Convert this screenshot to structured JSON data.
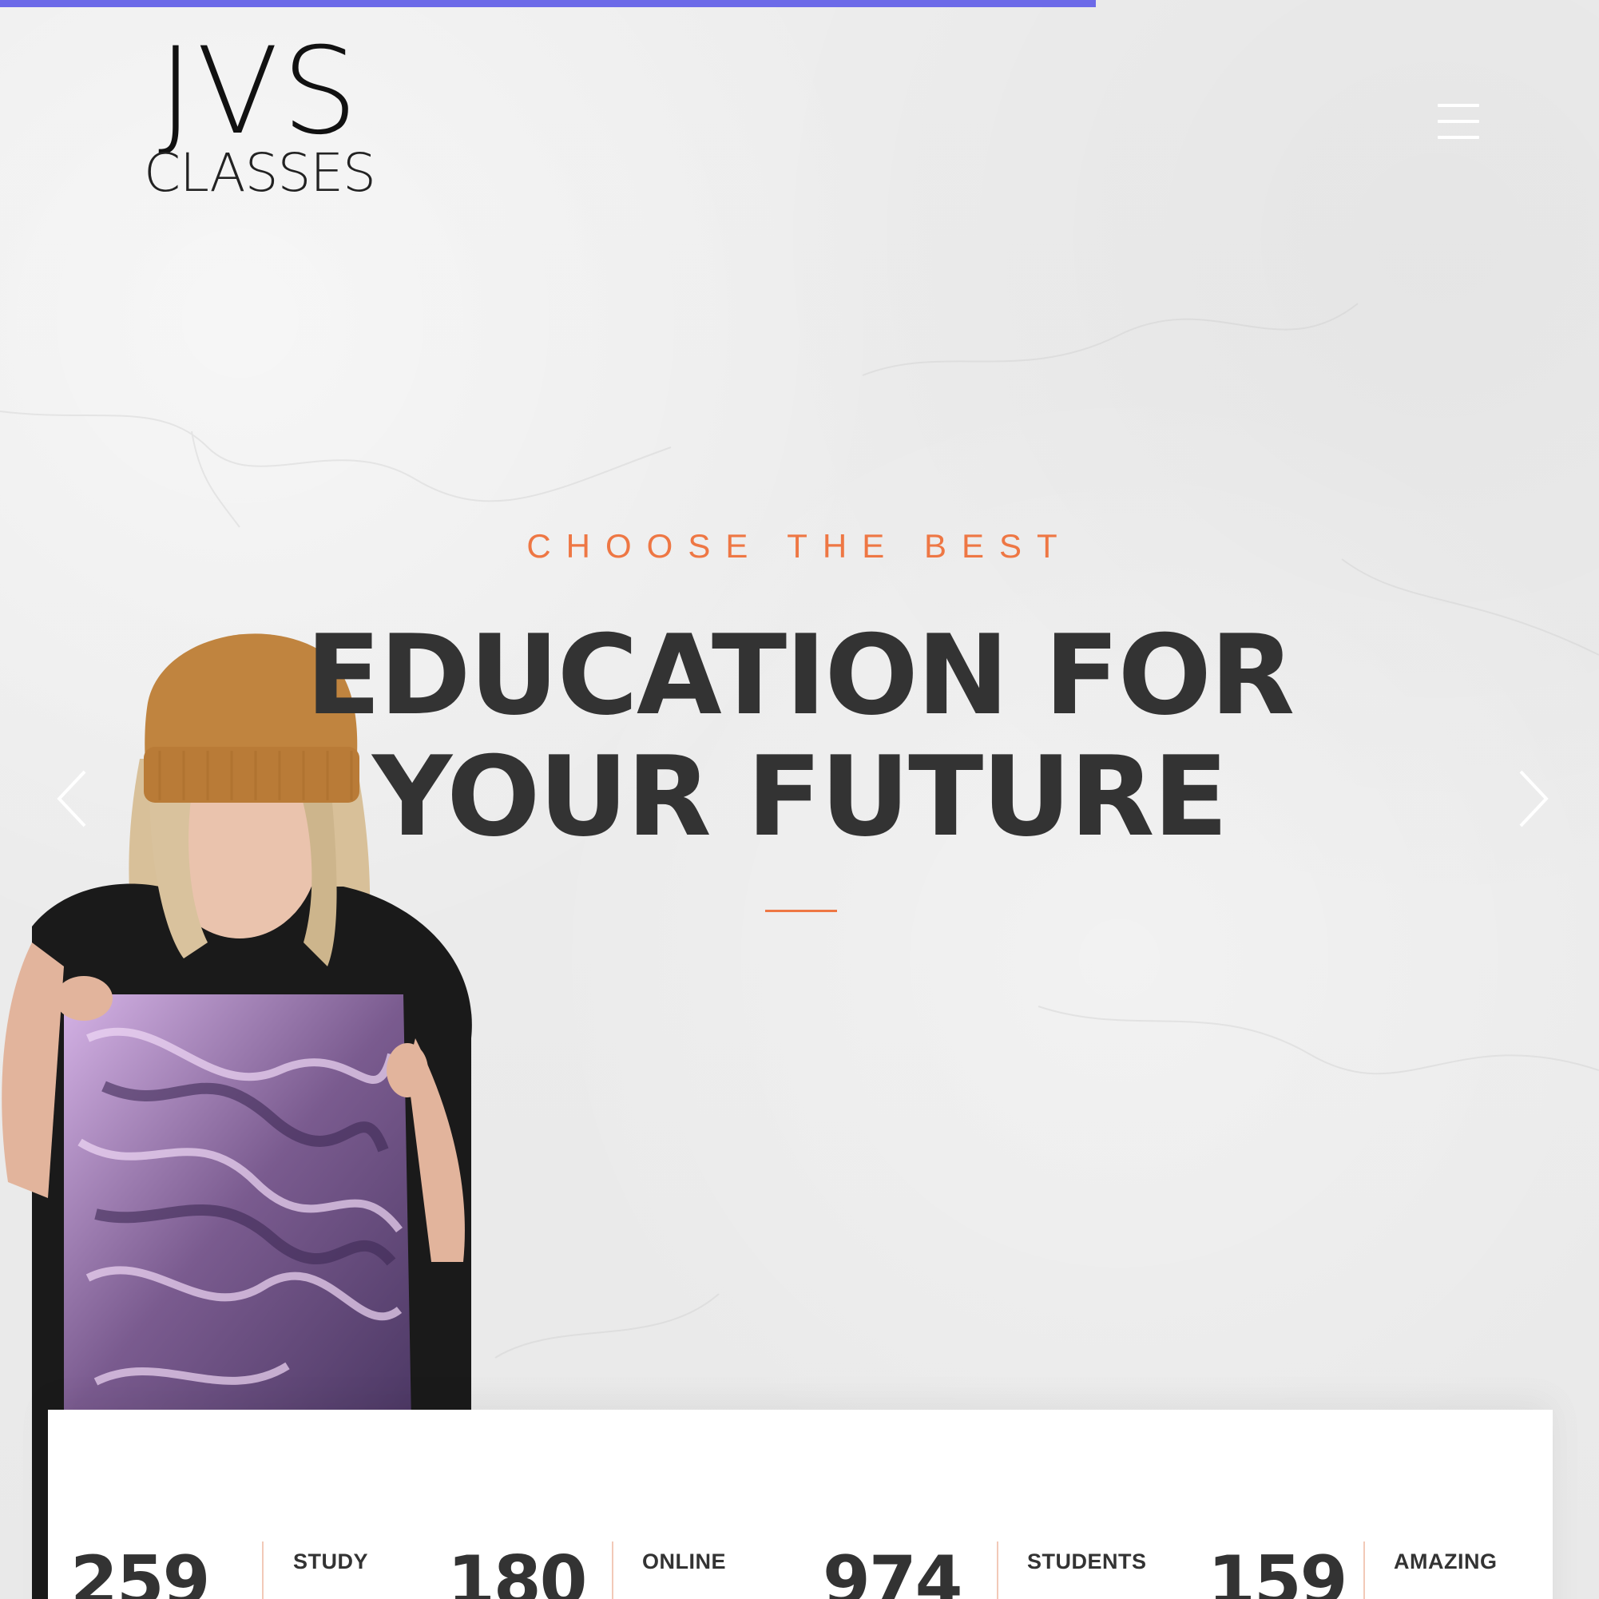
{
  "brand": {
    "logo_main": "JVS",
    "logo_sub": "CLASSES"
  },
  "hero": {
    "eyebrow": "CHOOSE THE BEST",
    "headline_line1": "EDUCATION FOR",
    "headline_line2": "YOUR FUTURE"
  },
  "icons": {
    "menu": "hamburger-menu-icon",
    "prev": "chevron-left-icon",
    "next": "chevron-right-icon"
  },
  "stats": [
    {
      "number": "259",
      "label": "STUDY"
    },
    {
      "number": "180",
      "label": "ONLINE"
    },
    {
      "number": "974",
      "label": "STUDENTS"
    },
    {
      "number": "159",
      "label": "AMAZING"
    }
  ],
  "colors": {
    "accent": "#ee7744",
    "progress": "#6c6ae8",
    "heading": "#333333",
    "background": "#ececec"
  }
}
